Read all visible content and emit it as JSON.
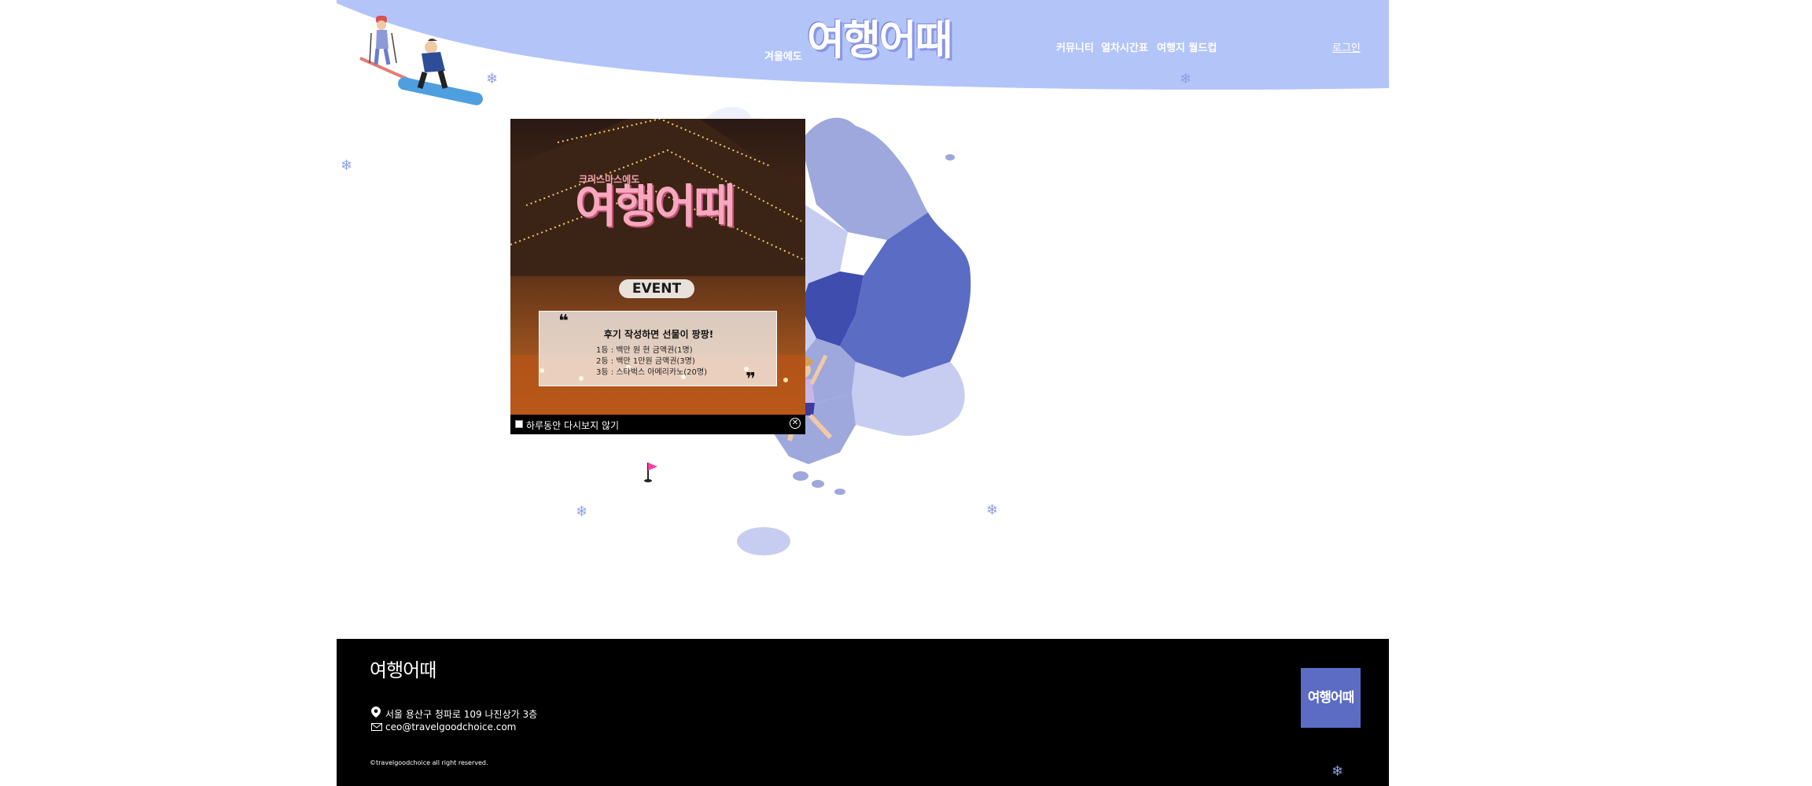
{
  "header": {
    "brand_small": "겨울에도",
    "brand_logo": "여행어때",
    "nav": [
      "커뮤니티",
      "열차시간표",
      "여행지 월드컵"
    ],
    "login": "로그인"
  },
  "popup": {
    "subtitle": "크리스마스에도",
    "title": "여행어때",
    "event": "EVENT",
    "quote_open": "❝",
    "quote_close": "❞",
    "headline": "후기 작성하면 선물이 팡팡!",
    "prizes": [
      "1등 : 백만 원 현 금액권(1명)",
      "2등 : 백만 1만원 금액권(3명)",
      "3등 : 스타벅스 아메리카노(20명)"
    ],
    "dont_show_label": "하루동안 다시보지 않기",
    "close_symbol": "✕"
  },
  "footer": {
    "logo": "여행어때",
    "address": "서울 용산구 청파로 109 나진상가 3층",
    "email": "ceo@travelgoodchoice.com",
    "copyright": "©travelgoodchoice all right reserved.",
    "badge": "여행어때"
  },
  "icons": {
    "snowflake": "❄",
    "location": "location-pin-icon",
    "mail": "mail-icon",
    "flag": "flag-icon"
  },
  "colors": {
    "header_blue": "#b3c4f9",
    "map_dark": "#3e4dae",
    "map_mid": "#5b6cc4",
    "map_light": "#9ea8dd",
    "map_pale": "#c7cdf0",
    "flag_pink": "#ff3aa3",
    "footer_bg": "#000000",
    "badge": "#5c6cc4"
  }
}
